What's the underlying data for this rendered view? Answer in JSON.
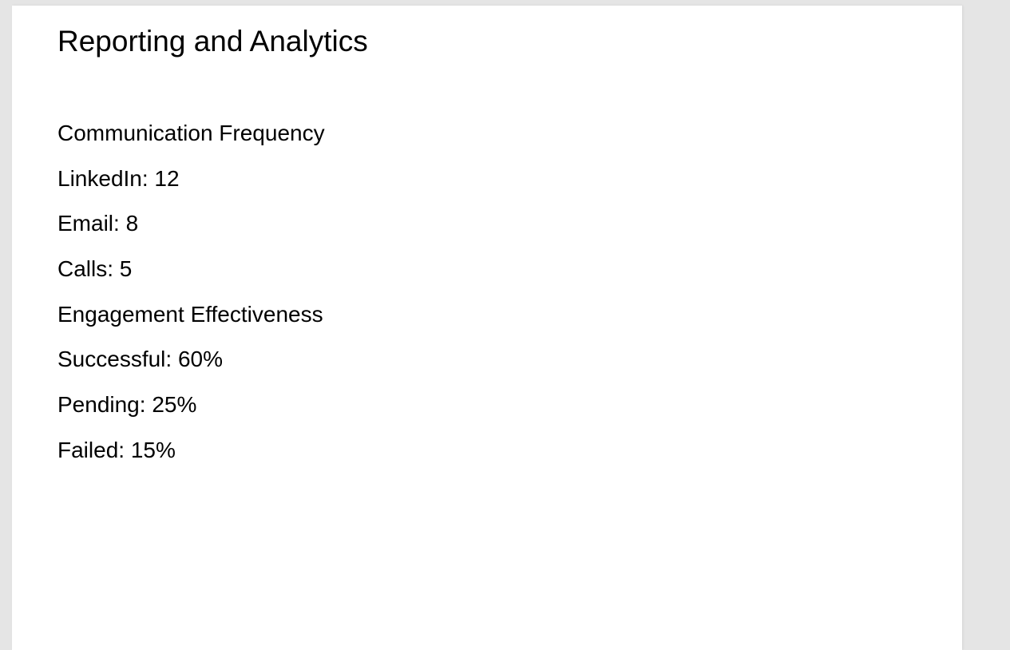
{
  "page": {
    "title": "Reporting and Analytics",
    "lines": [
      "Communication Frequency",
      "LinkedIn: 12",
      "Email: 8",
      "Calls: 5",
      "Engagement Effectiveness",
      "Successful: 60%",
      "Pending: 25%",
      "Failed: 15%"
    ]
  }
}
